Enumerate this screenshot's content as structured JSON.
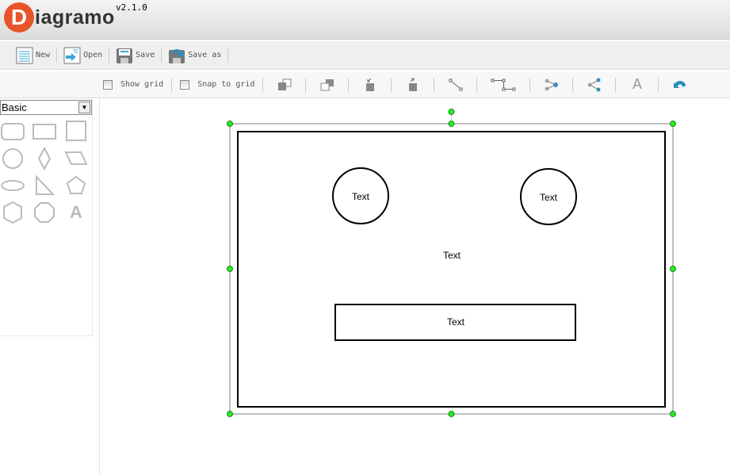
{
  "app": {
    "logo_letter": "D",
    "logo_text": "iagramo",
    "version": "v2.1.0"
  },
  "filebar": [
    {
      "label": "New",
      "icon": "new-icon"
    },
    {
      "label": "Open",
      "icon": "open-icon"
    },
    {
      "label": "Save",
      "icon": "save-icon"
    },
    {
      "label": "Save as",
      "icon": "save-as-icon"
    }
  ],
  "toolbar": {
    "show_grid": "Show grid",
    "snap_to_grid": "Snap to grid",
    "text_icon_glyph": "A"
  },
  "sidebar": {
    "shape_set": "Basic",
    "text_shape_glyph": "A"
  },
  "diagram": {
    "circle1_text": "Text",
    "circle2_text": "Text",
    "center_text": "Text",
    "rect_text": "Text"
  },
  "colors": {
    "accent": "#e8542a",
    "handle": "#22cc22",
    "icon_blue": "#2a8fc0"
  }
}
